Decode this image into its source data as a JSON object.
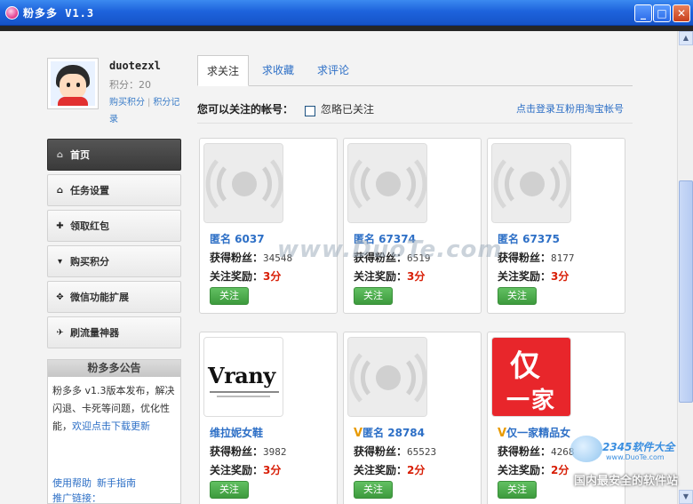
{
  "window": {
    "title": "粉多多 V1.3",
    "minimize": "_",
    "maximize": "□",
    "close": "✕"
  },
  "user": {
    "name": "duotezxl",
    "points": "积分：20",
    "buy_points": "购买积分",
    "separator": "|",
    "points_record": "积分记录"
  },
  "nav": {
    "items": [
      {
        "label": "首页",
        "icon": "home-icon",
        "glyph": "⌂"
      },
      {
        "label": "任务设置",
        "icon": "house-icon",
        "glyph": "⌂"
      },
      {
        "label": "领取红包",
        "icon": "gift-icon",
        "glyph": "✚"
      },
      {
        "label": "购买积分",
        "icon": "cart-icon",
        "glyph": "▾"
      },
      {
        "label": "微信功能扩展",
        "icon": "move-icon",
        "glyph": "✥"
      },
      {
        "label": "刷流量神器",
        "icon": "plane-icon",
        "glyph": "✈"
      }
    ]
  },
  "notice": {
    "title": "粉多多公告",
    "text": "粉多多 v1.3版本发布，解决闪退、卡死等问题，优化性能，",
    "link": "欢迎点击下载更新",
    "help": "使用帮助",
    "guide": "新手指南",
    "promo": "推广链接："
  },
  "tabs": [
    {
      "label": "求关注"
    },
    {
      "label": "求收藏"
    },
    {
      "label": "求评论"
    }
  ],
  "filter": {
    "label": "您可以关注的帐号：",
    "ignore": "忽略已关注",
    "taobao": "点击登录互粉用淘宝帐号"
  },
  "cards": [
    {
      "name": "匿名 6037",
      "v": "",
      "fans_label": "获得粉丝：",
      "fans": "34548",
      "reward_label": "关注奖励：",
      "reward": "3分",
      "button": "关注",
      "thumb": "signal"
    },
    {
      "name": "匿名 67374",
      "v": "",
      "fans_label": "获得粉丝：",
      "fans": "6519",
      "reward_label": "关注奖励：",
      "reward": "3分",
      "button": "关注",
      "thumb": "signal"
    },
    {
      "name": "匿名 67375",
      "v": "",
      "fans_label": "获得粉丝：",
      "fans": "8177",
      "reward_label": "关注奖励：",
      "reward": "3分",
      "button": "关注",
      "thumb": "signal"
    },
    {
      "name": "维拉妮女鞋",
      "v": "",
      "fans_label": "获得粉丝：",
      "fans": "3982",
      "reward_label": "关注奖励：",
      "reward": "3分",
      "button": "关注",
      "thumb": "vrany",
      "brand_text": "Vrany"
    },
    {
      "name": "匿名 28784",
      "v": "V",
      "fans_label": "获得粉丝：",
      "fans": "65523",
      "reward_label": "关注奖励：",
      "reward": "2分",
      "button": "关注",
      "thumb": "signal"
    },
    {
      "name": "仅一家精品女",
      "v": "V",
      "fans_label": "获得粉丝：",
      "fans": "4268",
      "reward_label": "关注奖励：",
      "reward": "2分",
      "button": "关注",
      "thumb": "red",
      "brand_c1": "仅",
      "brand_c2": "一家"
    }
  ],
  "watermarks": {
    "center": "www.DuoTe.com",
    "corner_brand": "2345软件大全",
    "corner_url": "www.DuoTe.com",
    "corner_slogan": "国内最安全的软件站"
  },
  "colors": {
    "accent_blue": "#2d6fc6",
    "reward_red": "#d81e06",
    "follow_green": "#3d9a3d",
    "title_blue": "#1e63dc"
  }
}
